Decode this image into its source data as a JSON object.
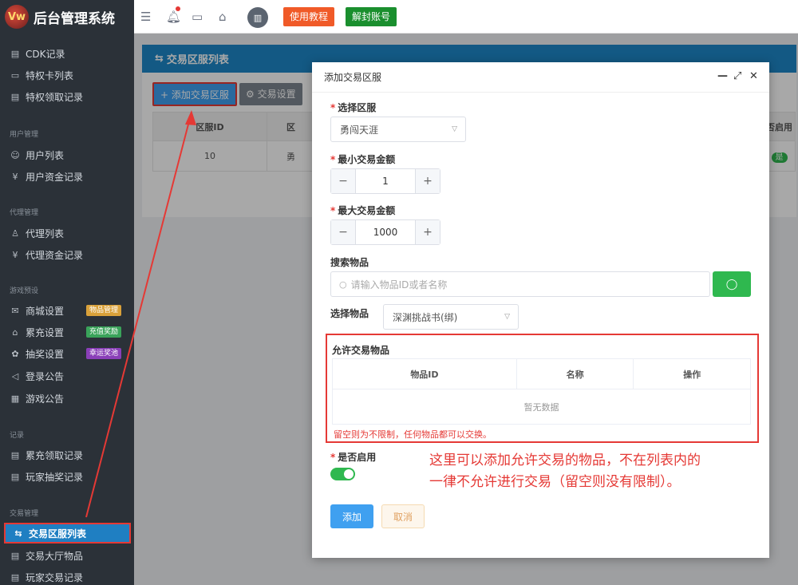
{
  "brand": {
    "logo_text": "Vw",
    "title": "后台管理系统"
  },
  "sidebar": {
    "items_top": [
      {
        "label": "CDK记录",
        "icon": "document-icon",
        "glyph": "▤"
      },
      {
        "label": "特权卡列表",
        "icon": "vip-card-icon",
        "glyph": "▭"
      },
      {
        "label": "特权领取记录",
        "icon": "clipboard-icon",
        "glyph": "▤"
      }
    ],
    "sections": {
      "user": "用户管理",
      "agent": "代理管理",
      "game": "游戏预设",
      "record": "记录",
      "trade": "交易管理"
    },
    "user_items": [
      {
        "label": "用户列表",
        "icon": "users-icon",
        "glyph": "☺"
      },
      {
        "label": "用户资金记录",
        "icon": "money-icon",
        "glyph": "¥"
      }
    ],
    "agent_items": [
      {
        "label": "代理列表",
        "icon": "agent-icon",
        "glyph": "♙"
      },
      {
        "label": "代理资金记录",
        "icon": "money-icon",
        "glyph": "¥"
      }
    ],
    "game_items": [
      {
        "label": "商城设置",
        "icon": "shop-icon",
        "glyph": "✉",
        "badge": "物品管理",
        "badge_color": "#d9a13a"
      },
      {
        "label": "累充设置",
        "icon": "lock-icon",
        "glyph": "⌂",
        "badge": "充值奖励",
        "badge_color": "#3aa35a"
      },
      {
        "label": "抽奖设置",
        "icon": "gear-icon",
        "glyph": "✿",
        "badge": "幸运奖池",
        "badge_color": "#8a3fb8"
      },
      {
        "label": "登录公告",
        "icon": "speaker-icon",
        "glyph": "◁"
      },
      {
        "label": "游戏公告",
        "icon": "calendar-icon",
        "glyph": "▦"
      }
    ],
    "record_items": [
      {
        "label": "累充领取记录",
        "icon": "list-icon",
        "glyph": "▤"
      },
      {
        "label": "玩家抽奖记录",
        "icon": "clipboard-icon",
        "glyph": "▤"
      }
    ],
    "trade_items": [
      {
        "label": "交易区服列表",
        "icon": "swap-icon",
        "glyph": "⇆",
        "active": true
      },
      {
        "label": "交易大厅物品",
        "icon": "clipboard-icon",
        "glyph": "▤"
      },
      {
        "label": "玩家交易记录",
        "icon": "history-icon",
        "glyph": "▤"
      }
    ]
  },
  "topbar": {
    "tutorial_label": "使用教程",
    "tutorial_color": "#f05a28",
    "unseal_label": "解封账号",
    "unseal_color": "#1a8f2e"
  },
  "page": {
    "title": "交易区服列表",
    "add_button": "添加交易区服",
    "settings_button": "交易设置",
    "table_headers": [
      "区服ID",
      "区",
      "",
      "",
      "",
      "否启用"
    ],
    "row": {
      "id": "10",
      "name": "勇",
      "enabled": "是"
    }
  },
  "dialog": {
    "title": "添加交易区服",
    "server_label": "选择区服",
    "server_value": "勇闯天涯",
    "min_label": "最小交易金额",
    "min_value": "1",
    "max_label": "最大交易金额",
    "max_value": "1000",
    "search_label": "搜索物品",
    "search_placeholder": "请输入物品ID或者名称",
    "select_item_label": "选择物品",
    "select_item_value": "深渊挑战书(绑)",
    "allow_title": "允许交易物品",
    "allow_headers": [
      "物品ID",
      "名称",
      "操作"
    ],
    "allow_empty": "暂无数据",
    "allow_hint": "留空则为不限制，任何物品都可以交换。",
    "enable_label": "是否启用",
    "add_button": "添加",
    "cancel_button": "取消"
  },
  "annotation": {
    "line1": "这里可以添加允许交易的物品，不在列表内的",
    "line2": "一律不允许进行交易（留空则没有限制）。"
  }
}
